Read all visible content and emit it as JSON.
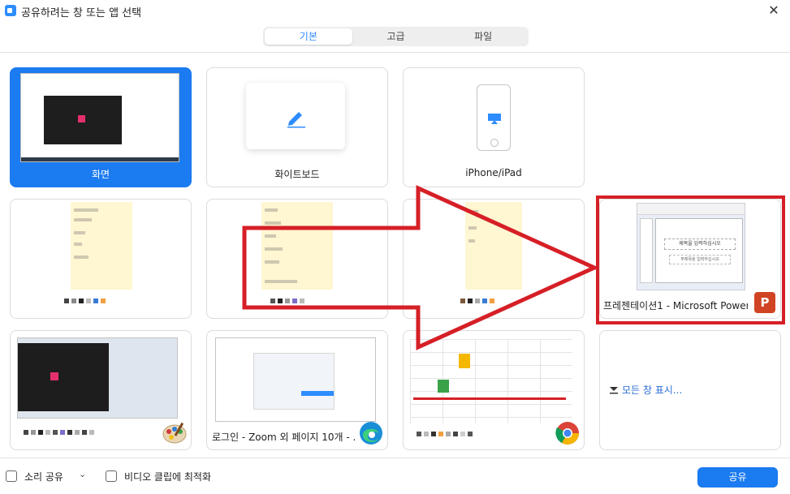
{
  "window": {
    "title": "공유하려는 창 또는 앱 선택",
    "close_glyph": "✕"
  },
  "tabs": [
    {
      "label": "기본",
      "active": true
    },
    {
      "label": "고급",
      "active": false
    },
    {
      "label": "파일",
      "active": false
    }
  ],
  "cards": {
    "screen": {
      "label": "화면",
      "selected": true
    },
    "whiteboard": {
      "label": "화이트보드"
    },
    "iphone": {
      "label": "iPhone/iPad"
    },
    "powerpoint": {
      "label": "프레젠테이션1 - Microsoft Power...",
      "slide_title": "제목을 입력하십시오",
      "slide_subtitle": "부제목을 입력하십시오",
      "app_icon": "powerpoint-icon"
    },
    "zoom_login": {
      "label": "로그인 - Zoom 외 페이지 10개 - ...",
      "app_icon": "edge-icon"
    },
    "paint": {
      "app_icon": "paint-icon"
    },
    "chrome": {
      "app_icon": "chrome-icon"
    }
  },
  "show_all": {
    "label": "모든 창 표시..."
  },
  "footer": {
    "sound_share": "소리 공유",
    "optimize_video": "비디오 클립에 최적화",
    "share_button": "공유"
  },
  "colors": {
    "accent": "#1b7bf0",
    "annotation": "#d61f26"
  }
}
